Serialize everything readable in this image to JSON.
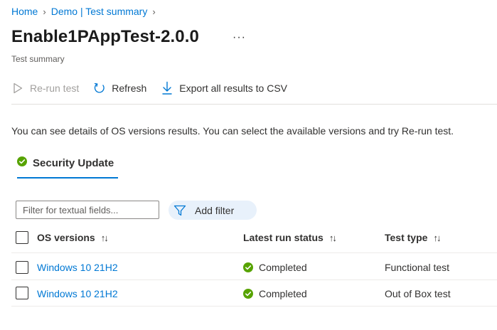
{
  "breadcrumb": {
    "items": [
      "Home",
      "Demo | Test summary"
    ]
  },
  "page": {
    "title": "Enable1PAppTest-2.0.0",
    "more_label": "···",
    "subtitle": "Test summary"
  },
  "toolbar": {
    "rerun_label": "Re-run test",
    "refresh_label": "Refresh",
    "export_label": "Export all results to CSV"
  },
  "info_text": "You can see details of OS versions results. You can select the available versions and try Re-run test.",
  "tab": {
    "label": "Security Update",
    "icon": "success-check-icon"
  },
  "filter": {
    "placeholder": "Filter for textual fields...",
    "add_filter_label": "Add filter"
  },
  "table": {
    "columns": [
      "OS versions",
      "Latest run status",
      "Test type"
    ],
    "sort_glyph": "↑↓",
    "rows": [
      {
        "os": "Windows 10 21H2",
        "status": "Completed",
        "type": "Functional test"
      },
      {
        "os": "Windows 10 21H2",
        "status": "Completed",
        "type": "Out of Box test"
      }
    ]
  },
  "colors": {
    "accent": "#0078d4",
    "success": "#57a300",
    "disabled": "#a19f9d",
    "filter_bg": "#e8f1fb"
  }
}
